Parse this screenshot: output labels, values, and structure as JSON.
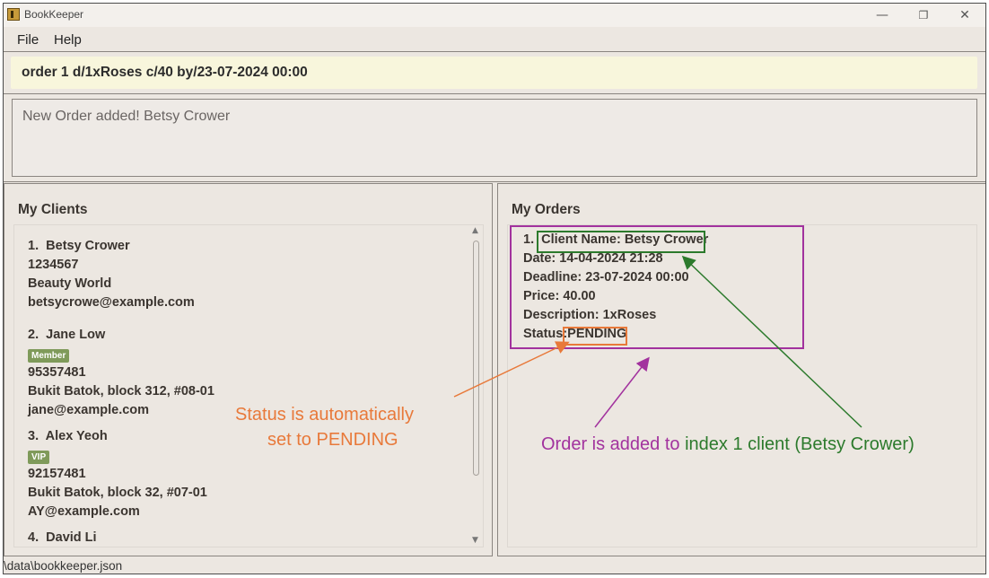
{
  "window": {
    "title": "BookKeeper",
    "minimize": "—",
    "restore": "❐",
    "close": "✕"
  },
  "menu": {
    "file": "File",
    "help": "Help"
  },
  "command": {
    "value": "order 1 d/1xRoses c/40 by/23-07-2024 00:00"
  },
  "result": {
    "message": "New Order added! Betsy Crower"
  },
  "clients": {
    "title": "My Clients",
    "items": [
      {
        "index": "1.",
        "name": "Betsy Crower",
        "tag": "",
        "phone": "1234567",
        "address": "Beauty World",
        "email": "betsycrowe@example.com"
      },
      {
        "index": "2.",
        "name": "Jane Low",
        "tag": "Member",
        "phone": "95357481",
        "address": "Bukit Batok, block 312, #08-01",
        "email": "jane@example.com"
      },
      {
        "index": "3.",
        "name": "Alex Yeoh",
        "tag": "VIP",
        "phone": "92157481",
        "address": "Bukit Batok, block 32, #07-01",
        "email": "AY@example.com"
      },
      {
        "index": "4.",
        "name": "David Li"
      }
    ]
  },
  "orders": {
    "title": "My Orders",
    "items": [
      {
        "index": "1.",
        "client": "Client Name: Betsy Crower",
        "date": "Date: 14-04-2024 21:28",
        "deadline": "Deadline: 23-07-2024 00:00",
        "price": "Price: 40.00",
        "description": "Description: 1xRoses",
        "status_label": "Status:",
        "status_value": "PENDING"
      }
    ]
  },
  "status_bar": {
    "path": "\\data\\bookkeeper.json"
  },
  "annotations": {
    "status_note_line1": "Status is automatically",
    "status_note_line2": "set to PENDING",
    "order_note_part1": "Order is added to ",
    "order_note_part2": "index 1 client (Betsy Crower)",
    "colors": {
      "orange": "#e8793a",
      "purple": "#a2329e",
      "green": "#2c7a2c"
    }
  }
}
